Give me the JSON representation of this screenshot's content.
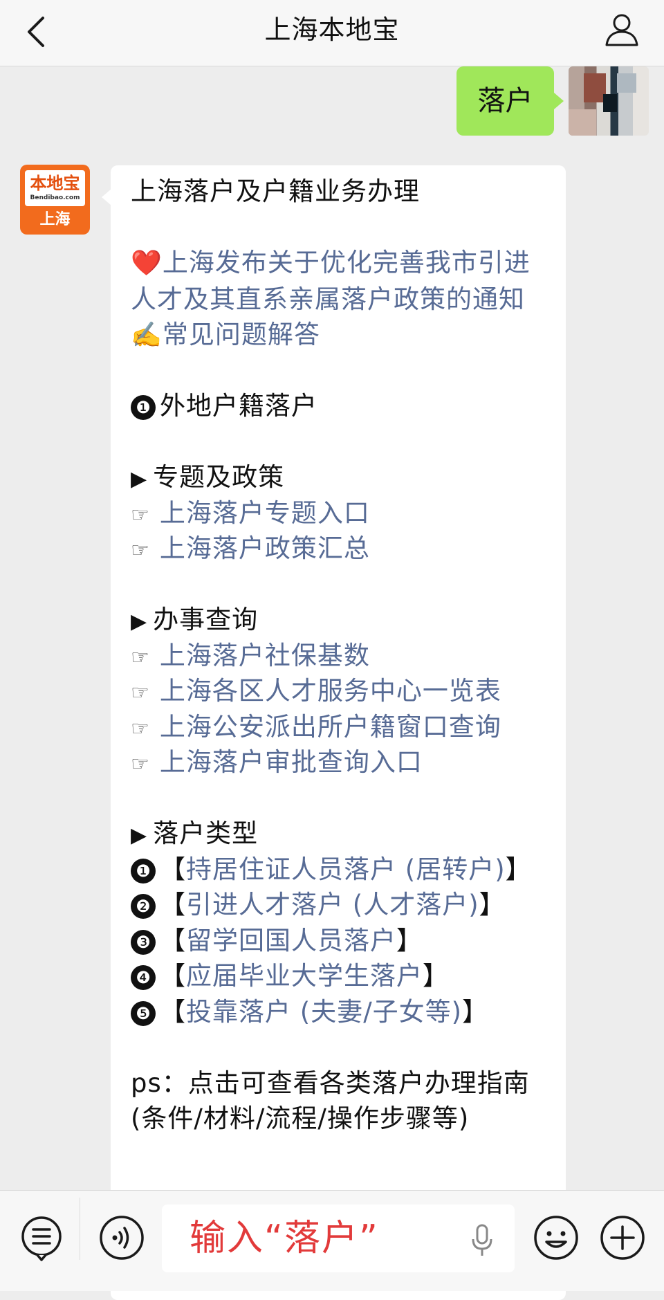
{
  "header": {
    "title": "上海本地宝",
    "back_icon": "chevron-left-icon",
    "profile_icon": "user-icon"
  },
  "user_message": {
    "text": "落户"
  },
  "bot": {
    "avatar": {
      "logo_text": "本地宝",
      "logo_domain": "Bendibao.com",
      "city": "上海"
    },
    "title": "上海落户及户籍业务办理",
    "featured_link": "上海发布关于优化完善我市引进人才及其直系亲属落户政策的通知",
    "faq_link": "常见问题解答",
    "section1_number": "❶",
    "section1_title": "外地户籍落户",
    "policy_heading": "专题及政策",
    "policy_links": [
      "上海落户专题入口",
      "上海落户政策汇总"
    ],
    "query_heading": "办事查询",
    "query_links": [
      "上海落户社保基数",
      "上海各区人才服务中心一览表",
      "上海公安派出所户籍窗口查询",
      "上海落户审批查询入口"
    ],
    "types_heading": "落户类型",
    "types": [
      {
        "num": "❶",
        "label": "持居住证人员落户 (居转户)"
      },
      {
        "num": "❷",
        "label": "引进人才落户 (人才落户)"
      },
      {
        "num": "❸",
        "label": "留学回国人员落户"
      },
      {
        "num": "❹",
        "label": "应届毕业大学生落户"
      },
      {
        "num": "❺",
        "label": "投靠落户 (夫妻/子女等)"
      }
    ],
    "ps_text": "ps：点击可查看各类落户办理指南(条件/材料/流程/操作步骤等)"
  },
  "input_bar": {
    "placeholder": "输入“落户”",
    "menu_icon": "menu-list-icon",
    "voice_icon": "voice-icon",
    "mic_icon": "microphone-icon",
    "emoji_icon": "emoji-icon",
    "plus_icon": "plus-icon"
  },
  "colors": {
    "link": "#576b95",
    "my_bubble": "#a0e75a",
    "accent_text": "#e23a3a"
  }
}
